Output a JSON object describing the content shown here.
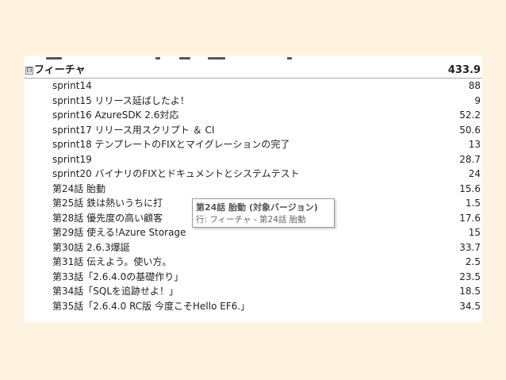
{
  "header": {
    "toggle_symbol": "⊟",
    "label": "フィーチャ",
    "value": "433.9"
  },
  "rows": [
    {
      "label": "sprint14",
      "value": "88"
    },
    {
      "label": "sprint15 リリース延ばしたよ！",
      "value": "9"
    },
    {
      "label": "sprint16 AzureSDK 2.6対応",
      "value": "52.2"
    },
    {
      "label": "sprint17 リリース用スクリプト ＆ CI",
      "value": "50.6"
    },
    {
      "label": "sprint18 テンプレートのFIXとマイグレーションの完了",
      "value": "13"
    },
    {
      "label": "sprint19",
      "value": "28.7"
    },
    {
      "label": "sprint20 バイナリのFIXとドキュメントとシステムテスト",
      "value": "24"
    },
    {
      "label": "第24話 胎動",
      "value": "15.6"
    },
    {
      "label": "第25話 鉄は熱いうちに打",
      "value": "1.5"
    },
    {
      "label": "第28話 優先度の高い顧客",
      "value": "17.6"
    },
    {
      "label": "第29話 使える!Azure Storage",
      "value": "15"
    },
    {
      "label": "第30話 2.6.3爆誕",
      "value": "33.7"
    },
    {
      "label": "第31話 伝えよう。使い方。",
      "value": "2.5"
    },
    {
      "label": "第33話「2.6.4.0の基礎作り」",
      "value": "23.5"
    },
    {
      "label": "第34話「SQLを追跡せよ！」",
      "value": "18.5"
    },
    {
      "label": "第35話「2.6.4.0 RC版 今度こそHello EF6.」",
      "value": "34.5"
    }
  ],
  "tooltip": {
    "title": "第24話 胎動 (対象バージョン)",
    "subtitle": "行: フィーチャ - 第24話 胎動"
  },
  "colors": {
    "background": "#fdf3de",
    "panel": "#ffffff",
    "header_border": "#9aaed0"
  }
}
